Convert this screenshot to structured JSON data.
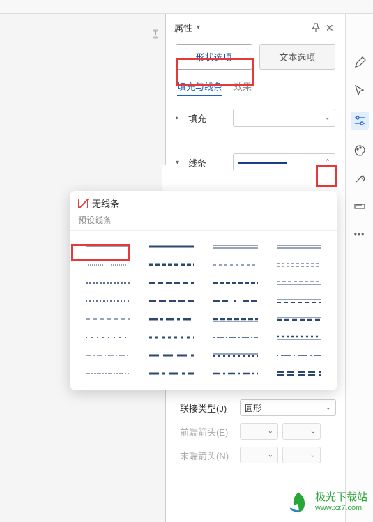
{
  "panel": {
    "title": "属性",
    "tab_shape": "形状选项",
    "tab_text": "文本选项",
    "subtab_fill_line": "填充与线条",
    "subtab_effect": "效果",
    "fill_label": "填充",
    "line_label": "线条"
  },
  "popup": {
    "no_line": "无线条",
    "preset_label": "预设线条"
  },
  "lower": {
    "join_type": "联接类型(J)",
    "join_value": "圆形",
    "start_arrow": "前端箭头(E)",
    "end_arrow": "末端箭头(N)"
  },
  "side_icons": {
    "minimize": "minimize-icon",
    "pencil": "pencil-icon",
    "cursor": "cursor-icon",
    "sliders": "sliders-icon",
    "palette": "palette-icon",
    "tools": "tools-icon",
    "ruler": "ruler-icon",
    "more": "more-icon"
  },
  "watermark": {
    "line1": "极光下载站",
    "line2": "www.xz7.com"
  },
  "chart_data": {
    "type": "table",
    "description": "Line style presets grid (4 columns × 8 rows)",
    "columns": [
      "col1",
      "col2",
      "col3",
      "col4"
    ],
    "rows": [
      [
        "thin-solid",
        "medium-solid",
        "double-thin",
        "thin-gap-thin"
      ],
      [
        "dotted-fine",
        "dash-medium",
        "dash-thin-spaced",
        "dash-double-thin"
      ],
      [
        "dash-short",
        "dash-bold",
        "dash-triple",
        "dash-thin-under"
      ],
      [
        "dotted-square",
        "dash-long-bold",
        "dash-bold-pair",
        "dash-over-line"
      ],
      [
        "dash-sparse",
        "long-short",
        "bold-dash-thin",
        "thin-bold-gap"
      ],
      [
        "dot-wide",
        "bold-dots",
        "dot-line",
        "bold-dots-line"
      ],
      [
        "dash-dot-dot",
        "bold-gap-wide",
        "thin-bold-dot",
        "dot-line-dot"
      ],
      [
        "morse-like",
        "bold-dash-wide",
        "bold-dot-gap",
        "double-bold-gap"
      ]
    ]
  }
}
